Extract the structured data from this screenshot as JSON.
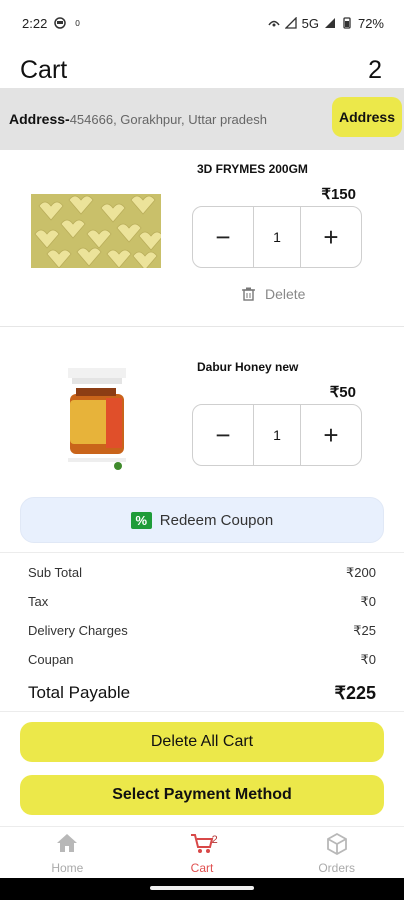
{
  "status_bar": {
    "time": "2:22",
    "network": "5G",
    "battery": "72%"
  },
  "header": {
    "title": "Cart",
    "count": "2"
  },
  "address": {
    "label": "Address-",
    "value": "454666, Gorakhpur, Uttar pradesh",
    "button_label": "Address"
  },
  "items": [
    {
      "name": "3D FRYMES 200GM",
      "price": "₹150",
      "quantity": "1",
      "delete_label": "Delete"
    },
    {
      "name": "Dabur Honey new",
      "price": "₹50",
      "quantity": "1"
    }
  ],
  "coupon": {
    "label": "Redeem Coupon"
  },
  "summary": {
    "sub_total_label": "Sub Total",
    "sub_total": "₹200",
    "tax_label": "Tax",
    "tax": "₹0",
    "delivery_label": "Delivery Charges",
    "delivery": "₹25",
    "coupon_label": "Coupan",
    "coupon": "₹0",
    "total_label": "Total Payable",
    "total": "₹225"
  },
  "actions": {
    "delete_all": "Delete All Cart",
    "payment": "Select Payment Method"
  },
  "nav": {
    "home": "Home",
    "cart": "Cart",
    "cart_badge": "2",
    "orders": "Orders"
  },
  "colors": {
    "accent": "#ece84a",
    "coupon_bg": "#e8f0fd",
    "coupon_icon": "#1f9c39",
    "nav_active": "#e05050"
  }
}
